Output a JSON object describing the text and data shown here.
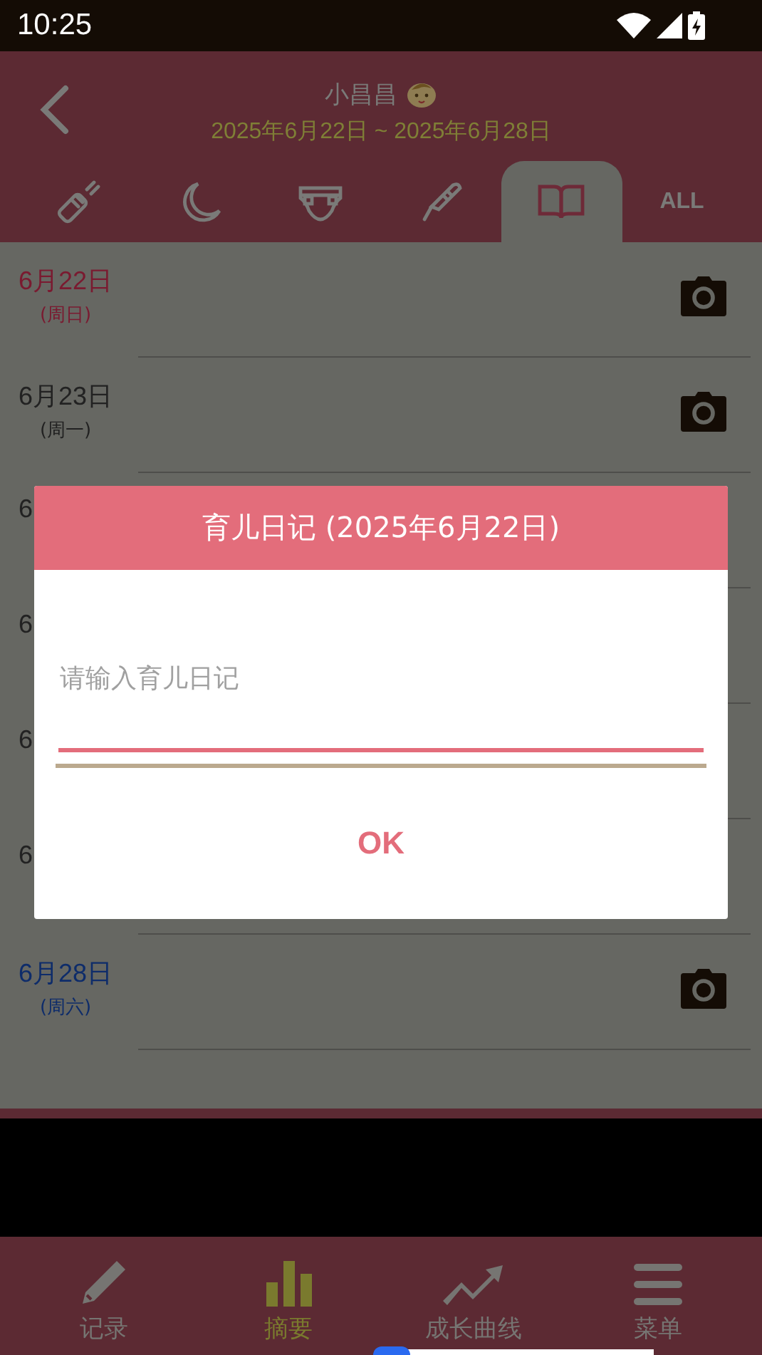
{
  "status_bar": {
    "time": "10:25"
  },
  "header": {
    "title": "小昌昌",
    "date_range": "2025年6月22日 ~ 2025年6月28日"
  },
  "tabs": [
    {
      "kind": "bottle",
      "selected": false
    },
    {
      "kind": "moon",
      "selected": false
    },
    {
      "kind": "diaper",
      "selected": false
    },
    {
      "kind": "thermometer",
      "selected": false
    },
    {
      "kind": "book",
      "selected": true
    },
    {
      "kind": "text",
      "label": "ALL",
      "selected": false
    }
  ],
  "days": [
    {
      "date": "6月22日",
      "weekday": "(周日)",
      "color": "#7a1a30"
    },
    {
      "date": "6月23日",
      "weekday": "(周一)",
      "color": "#222222"
    },
    {
      "date": "6",
      "color": "#222222"
    },
    {
      "date": "6",
      "color": "#222222"
    },
    {
      "date": "6",
      "color": "#222222"
    },
    {
      "date": "6",
      "color": "#222222"
    },
    {
      "date": "6月28日",
      "weekday": "(周六)",
      "color": "#0e2c6a"
    }
  ],
  "dialog": {
    "title": "育儿日记 (2025年6月22日)",
    "placeholder": "请输入育儿日记",
    "button": "OK"
  },
  "nav": [
    {
      "kind": "pencil",
      "label": "记录",
      "selected": false
    },
    {
      "kind": "chart",
      "label": "摘要",
      "selected": true
    },
    {
      "kind": "trend",
      "label": "成长曲线",
      "selected": false
    },
    {
      "kind": "menu",
      "label": "菜单",
      "selected": false
    }
  ]
}
